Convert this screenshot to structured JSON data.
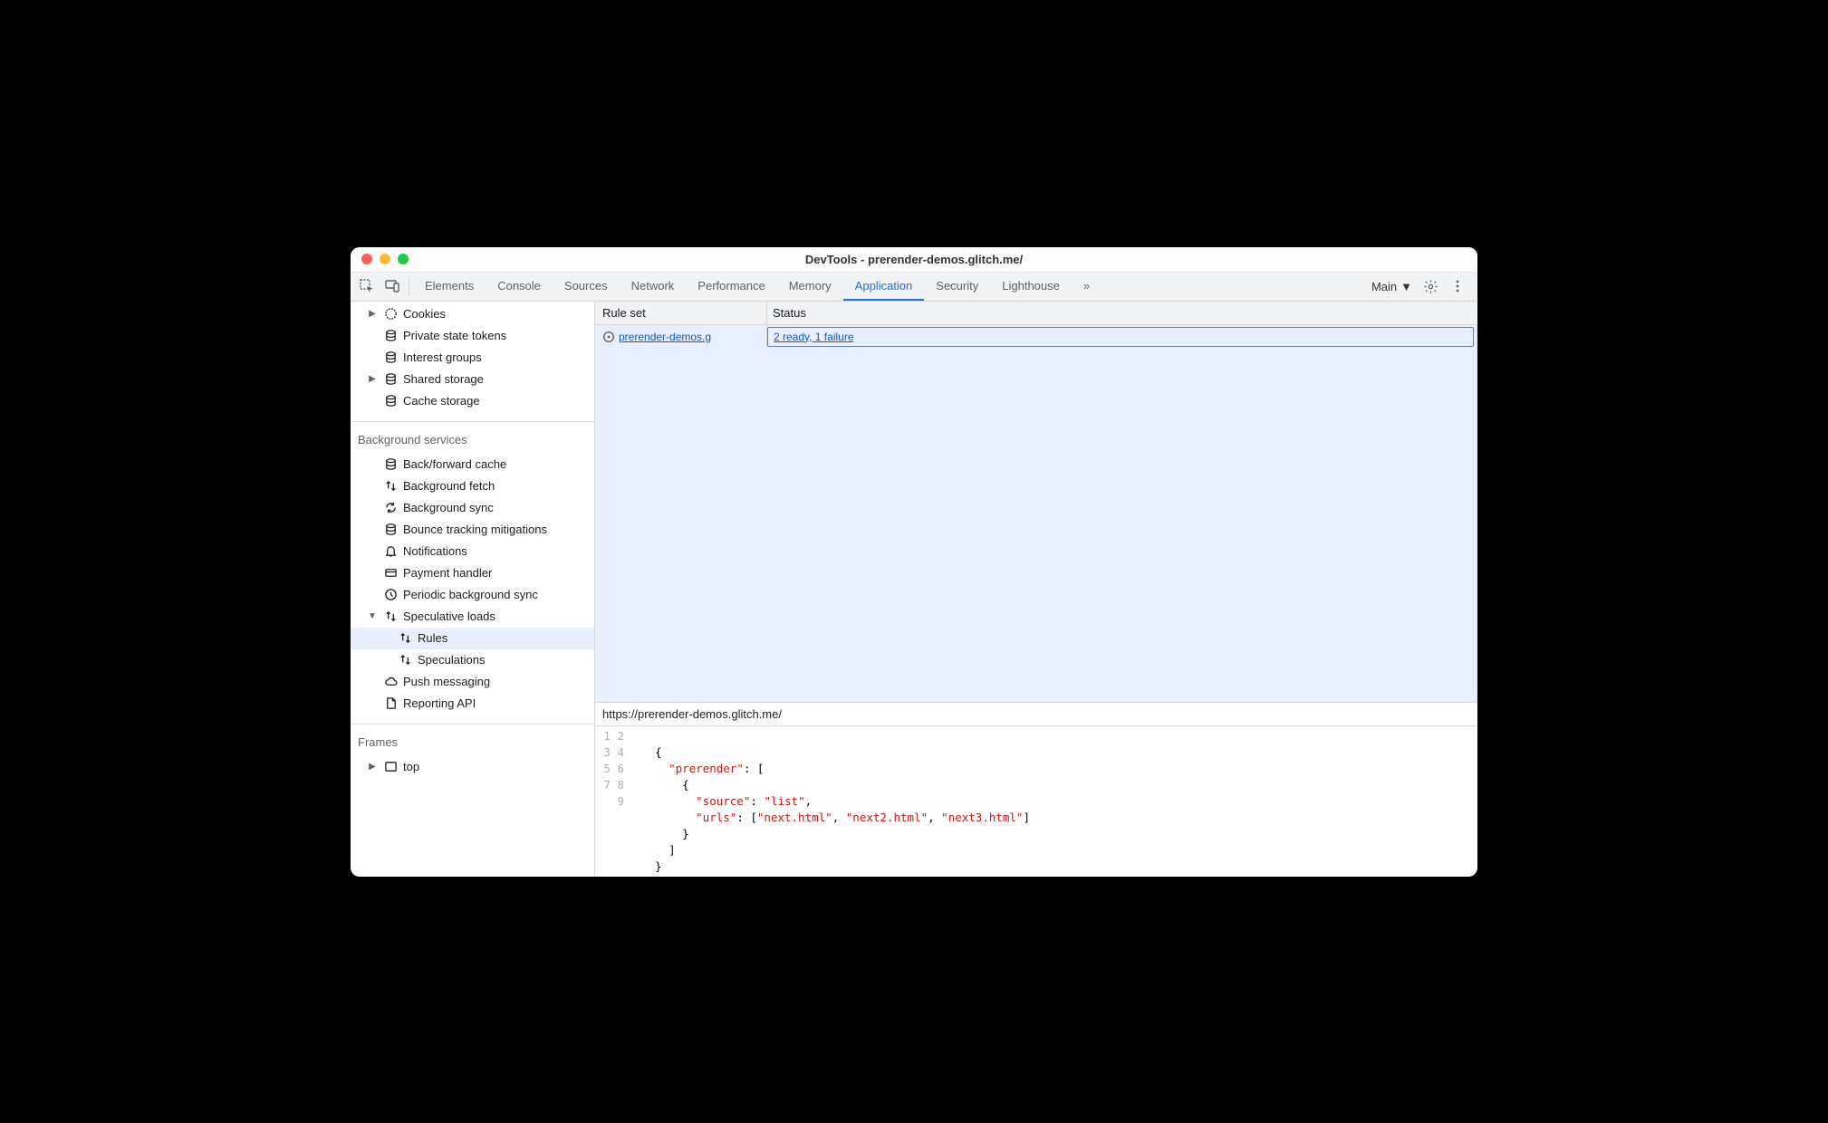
{
  "titlebar": {
    "title": "DevTools - prerender-demos.glitch.me/"
  },
  "toolbar": {
    "tabs": [
      "Elements",
      "Console",
      "Sources",
      "Network",
      "Performance",
      "Memory",
      "Application",
      "Security",
      "Lighthouse"
    ],
    "overflow": "»",
    "target": "Main",
    "active_tab": "Application"
  },
  "sidebar": {
    "top_items": [
      {
        "label": "Cookies",
        "icon": "cookie",
        "arrow": "right",
        "indent": 1
      },
      {
        "label": "Private state tokens",
        "icon": "db",
        "arrow": "",
        "indent": 1
      },
      {
        "label": "Interest groups",
        "icon": "db",
        "arrow": "",
        "indent": 1
      },
      {
        "label": "Shared storage",
        "icon": "db",
        "arrow": "right",
        "indent": 1
      },
      {
        "label": "Cache storage",
        "icon": "db",
        "arrow": "",
        "indent": 1
      }
    ],
    "section_bg_title": "Background services",
    "bg_items": [
      {
        "label": "Back/forward cache",
        "icon": "db",
        "arrow": "",
        "indent": 1
      },
      {
        "label": "Background fetch",
        "icon": "updown",
        "arrow": "",
        "indent": 1
      },
      {
        "label": "Background sync",
        "icon": "sync",
        "arrow": "",
        "indent": 1
      },
      {
        "label": "Bounce tracking mitigations",
        "icon": "db",
        "arrow": "",
        "indent": 1
      },
      {
        "label": "Notifications",
        "icon": "bell",
        "arrow": "",
        "indent": 1
      },
      {
        "label": "Payment handler",
        "icon": "card",
        "arrow": "",
        "indent": 1
      },
      {
        "label": "Periodic background sync",
        "icon": "clock",
        "arrow": "",
        "indent": 1
      },
      {
        "label": "Speculative loads",
        "icon": "updown",
        "arrow": "down",
        "indent": 1
      },
      {
        "label": "Rules",
        "icon": "updown",
        "arrow": "",
        "indent": 2,
        "selected": true
      },
      {
        "label": "Speculations",
        "icon": "updown",
        "arrow": "",
        "indent": 2
      },
      {
        "label": "Push messaging",
        "icon": "cloud",
        "arrow": "",
        "indent": 1
      },
      {
        "label": "Reporting API",
        "icon": "doc",
        "arrow": "",
        "indent": 1
      }
    ],
    "section_frames_title": "Frames",
    "frames_items": [
      {
        "label": "top",
        "icon": "frame",
        "arrow": "right",
        "indent": 1
      }
    ]
  },
  "grid": {
    "headers": {
      "ruleset": "Rule set",
      "status": "Status"
    },
    "row": {
      "ruleset_label": " prerender-demos.g",
      "status_label": "2 ready, 1 failure"
    }
  },
  "detail": {
    "url": "https://prerender-demos.glitch.me/",
    "code_lines": [
      "",
      "{",
      "  \"prerender\": [",
      "    {",
      "      \"source\": \"list\",",
      "      \"urls\": [\"next.html\", \"next2.html\", \"next3.html\"]",
      "    }",
      "  ]",
      "}"
    ]
  }
}
